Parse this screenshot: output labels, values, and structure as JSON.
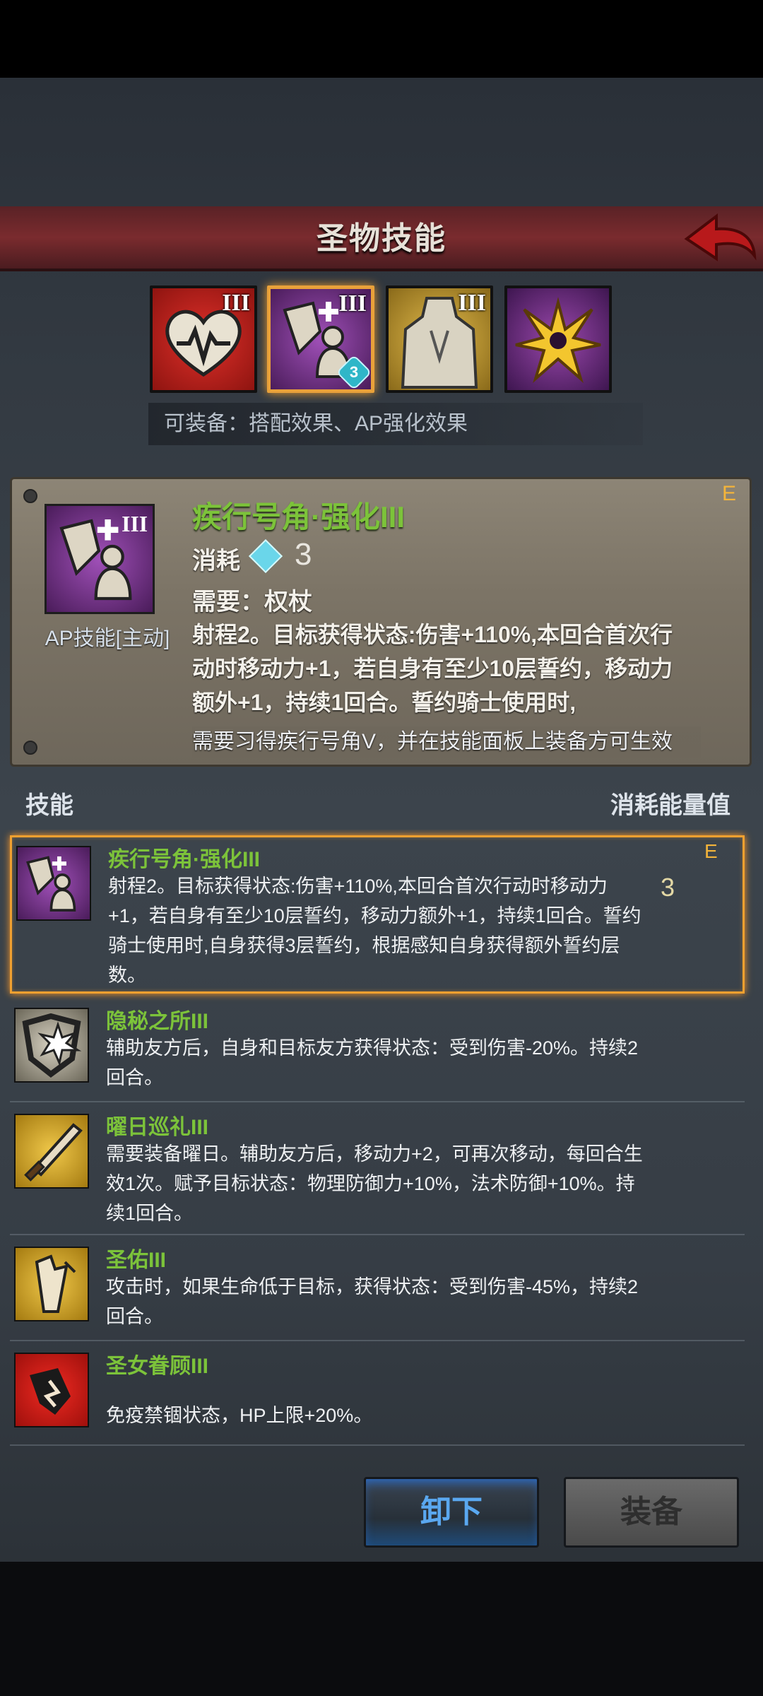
{
  "header": {
    "title": "圣物技能",
    "back_icon": "back-arrow-icon"
  },
  "relics": [
    {
      "icon": "heart-pulse-icon",
      "rank": "III",
      "color": "#c0241e",
      "selected": false
    },
    {
      "icon": "horn-knight-icon",
      "rank": "III",
      "color": "#7a3a8c",
      "selected": true,
      "badge": "3"
    },
    {
      "icon": "stone-knight-icon",
      "rank": "III",
      "color": "#c9a23a",
      "selected": false
    },
    {
      "icon": "golden-sun-icon",
      "rank": "",
      "color": "#6a2e7c",
      "selected": false
    }
  ],
  "equip_hint": "可装备：搭配效果、AP强化效果",
  "detail": {
    "name": "疾行号角·强化III",
    "grade": "E",
    "type": "AP技能[主动]",
    "cost_label": "消耗",
    "cost_value": "3",
    "requirement": "需要：权杖",
    "description": "射程2。目标获得状态:伤害+110%,本回合首次行动时移动力+1，若自身有至少10层誓约，移动力额外+1，持续1回合。誓约骑士使用时,",
    "note": "需要习得疾行号角V，并在技能面板上装备方可生效"
  },
  "list_header": {
    "left": "技能",
    "right": "消耗能量值"
  },
  "skills": [
    {
      "name": "疾行号角·强化III",
      "desc": "射程2。目标获得状态:伤害+110%,本回合首次行动时移动力+1，若自身有至少10层誓约，移动力额外+1，持续1回合。誓约骑士使用时,自身获得3层誓约，根据感知自身获得额外誓约层数。",
      "cost": "3",
      "grade": "E",
      "icon": "horn-knight-icon"
    },
    {
      "name": "隐秘之所III",
      "desc": "辅助友方后，自身和目标友方获得状态：受到伤害-20%。持续2回合。",
      "cost": "",
      "grade": "",
      "icon": "hidden-shield-icon"
    },
    {
      "name": "曜日巡礼III",
      "desc": "需要装备曜日。辅助友方后，移动力+2，可再次移动，每回合生效1次。赋予目标状态：物理防御力+10%，法术防御+10%。持续1回合。",
      "cost": "",
      "grade": "",
      "icon": "sun-sword-icon"
    },
    {
      "name": "圣佑III",
      "desc": "攻击时，如果生命低于目标，获得状态：受到伤害-45%，持续2回合。",
      "cost": "",
      "grade": "",
      "icon": "holy-blessing-icon"
    },
    {
      "name": "圣女眷顾III",
      "desc": "免疫禁锢状态，HP上限+20%。",
      "cost": "",
      "grade": "",
      "icon": "saint-favor-icon"
    }
  ],
  "buttons": {
    "unequip": "卸下",
    "equip": "装备"
  }
}
